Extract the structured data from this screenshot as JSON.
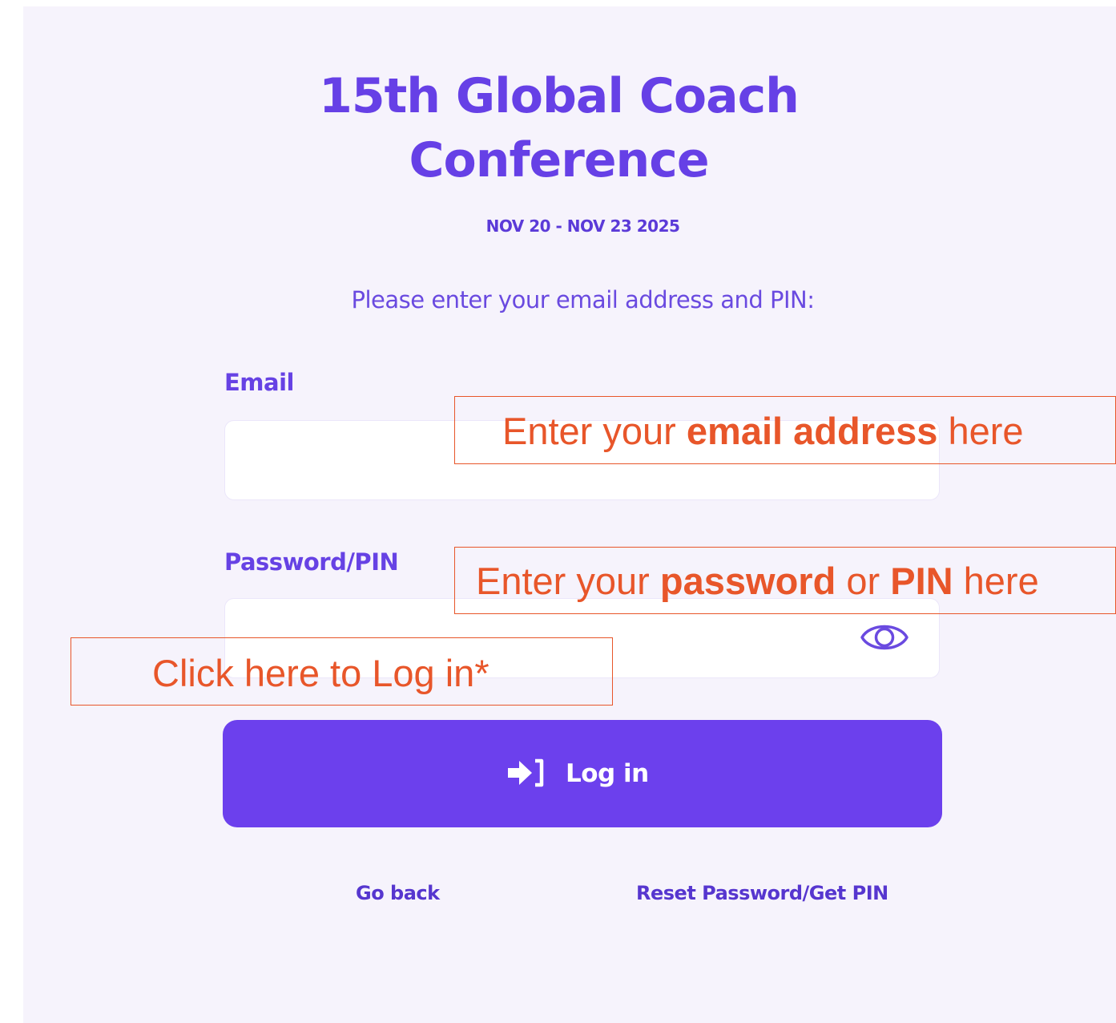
{
  "event": {
    "title_line1": "15th Global Coach",
    "title_line2": "Conference",
    "dates": "NOV 20 - NOV 23 2025"
  },
  "form": {
    "instructions": "Please enter your email address and PIN:",
    "email_label": "Email",
    "email_value": "",
    "pin_label": "Password/PIN",
    "pin_value": "",
    "login_label": "Log in",
    "go_back": "Go back",
    "reset": "Reset Password/Get PIN"
  },
  "icons": {
    "password_toggle": "eye-icon",
    "login": "login-arrow-icon"
  },
  "annotations": {
    "email": {
      "pre": "Enter your ",
      "bold": "email address",
      "post": " here"
    },
    "pin": {
      "pre": "Enter your ",
      "bold1": "password",
      "mid": " or ",
      "bold2": "PIN",
      "post": " here"
    },
    "login": "Click here to Log in*"
  },
  "colors": {
    "accent": "#6c40ed",
    "heading": "#6640e6",
    "panel_bg": "#f6f3fc",
    "annotation": "#e8562a"
  }
}
